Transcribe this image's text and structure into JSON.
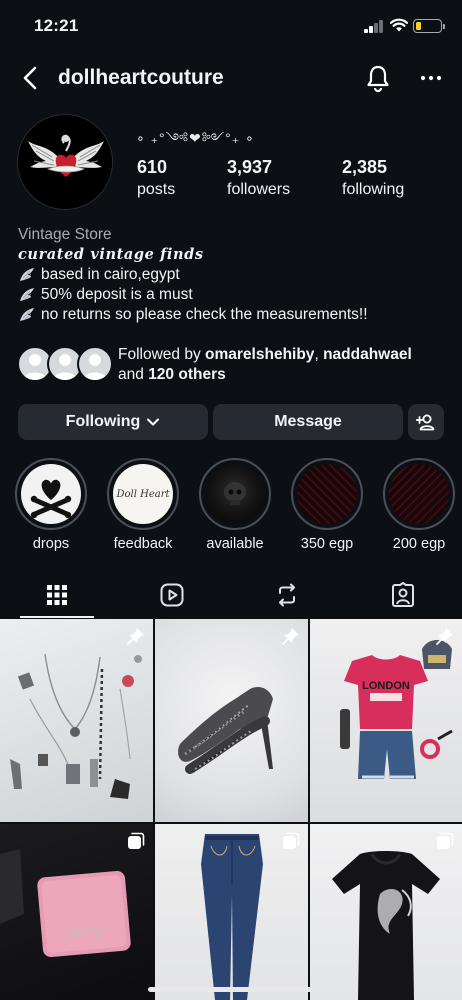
{
  "status_bar": {
    "time": "12:21"
  },
  "header": {
    "username": "dollheartcouture",
    "icons": [
      "back-icon",
      "bell-icon",
      "more-icon"
    ]
  },
  "profile": {
    "decorative_name": "∘ ₊°༺❤︎༻°₊ ∘",
    "stats": [
      {
        "number": "610",
        "label": "posts"
      },
      {
        "number": "3,937",
        "label": "followers"
      },
      {
        "number": "2,385",
        "label": "following"
      }
    ],
    "bio": {
      "category": "Vintage Store",
      "tagline": "curated vintage finds",
      "lines": [
        "based in cairo,egypt",
        "50% deposit is a must",
        "no returns so please check the measurements!!"
      ]
    },
    "followed_by": {
      "prefix": "Followed by",
      "user1": "omarelshehiby",
      "separator": ",",
      "user2": "naddahwael",
      "middle": "and",
      "others": "120 others"
    }
  },
  "buttons": {
    "following": "Following",
    "message": "Message"
  },
  "highlights": [
    {
      "label": "drops",
      "cover": "skull-crossbones"
    },
    {
      "label": "feedback",
      "cover": "Doll Heart"
    },
    {
      "label": "available",
      "cover": "dark-skull"
    },
    {
      "label": "350 egp",
      "cover": "dark-red-pattern"
    },
    {
      "label": "200 egp",
      "cover": "dark-red-pattern"
    }
  ],
  "tabs": [
    "grid-icon",
    "reels-icon",
    "reposts-icon",
    "tagged-icon"
  ],
  "grid_posts": [
    {
      "subject": "jewelry-flatlay",
      "badge": "pin-icon"
    },
    {
      "subject": "studded-heels",
      "badge": "pin-icon"
    },
    {
      "subject": "london-tee-outfit",
      "badge": "pin-icon"
    },
    {
      "subject": "pink-juicy-wallet",
      "badge": "multi-icon",
      "text": "Juicy"
    },
    {
      "subject": "flare-jeans",
      "badge": "multi-icon"
    },
    {
      "subject": "black-graphic-top",
      "badge": "multi-icon"
    }
  ],
  "highlight_text": {
    "doll_heart": "Doll Heart"
  },
  "colors": {
    "background": "#0c0f14",
    "button": "#262a31",
    "battery": "#f5d327"
  }
}
